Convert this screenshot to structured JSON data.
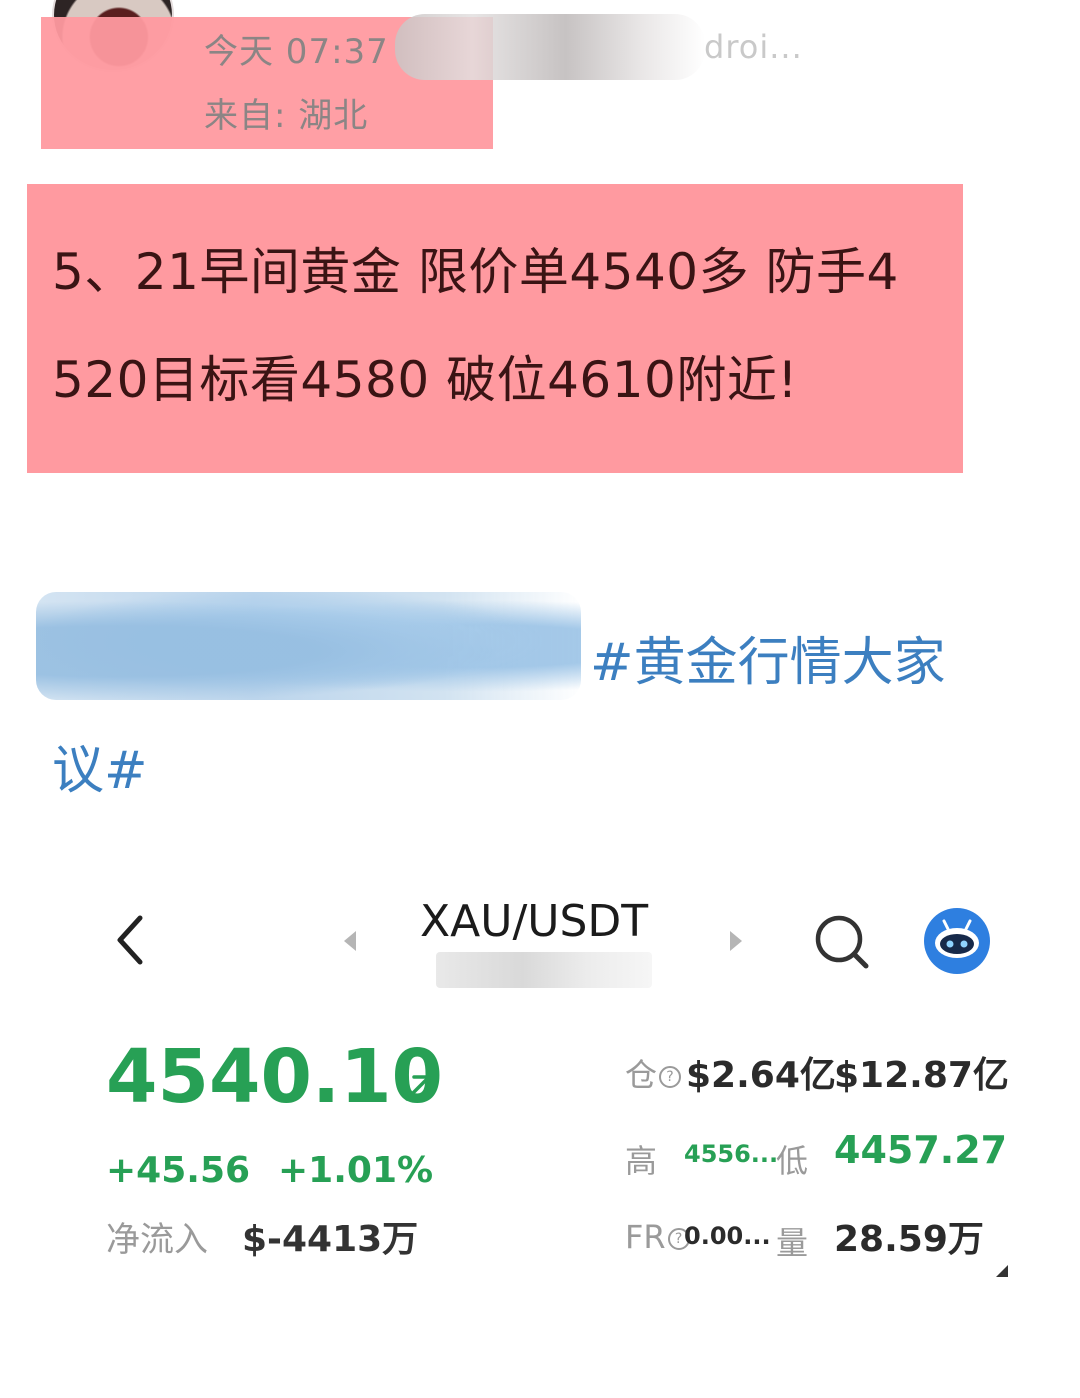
{
  "post": {
    "time": "今天 07:37",
    "device": "droi...",
    "location": "来自: 湖北",
    "body_line_1": "5、21早间黄金 限价单4540多 防手4",
    "body_line_2": "520目标看4580 破位4610附近!",
    "hashtag_line_1": "#黄金行情大家",
    "hashtag_line_2": "议#",
    "highlight_color": "#ff9aa0",
    "hashtag_color": "#3c7fc0"
  },
  "ticker": {
    "pair": "XAU/USDT",
    "price": "4540.10",
    "change_abs": "+45.56",
    "change_pct": "+1.01%",
    "netflow_label": "净流入",
    "netflow_value": "$-4413万",
    "open_interest_label": "仓",
    "open_interest_value": "$2.64亿",
    "volume_usd": "$12.87亿",
    "high_label": "高",
    "high_value": "4556...",
    "low_label": "低",
    "low_value": "4457.27",
    "funding_label": "FR",
    "funding_value": "0.00...",
    "volume_label": "量",
    "volume_value": "28.59万",
    "up_color": "#27a055",
    "icons": {
      "back": "chevron-left-icon",
      "prev": "triangle-left-icon",
      "next": "triangle-right-icon",
      "search": "search-icon",
      "assistant": "robot-icon",
      "trend": "arrow-up-right-icon",
      "help": "question-circle-icon"
    }
  }
}
